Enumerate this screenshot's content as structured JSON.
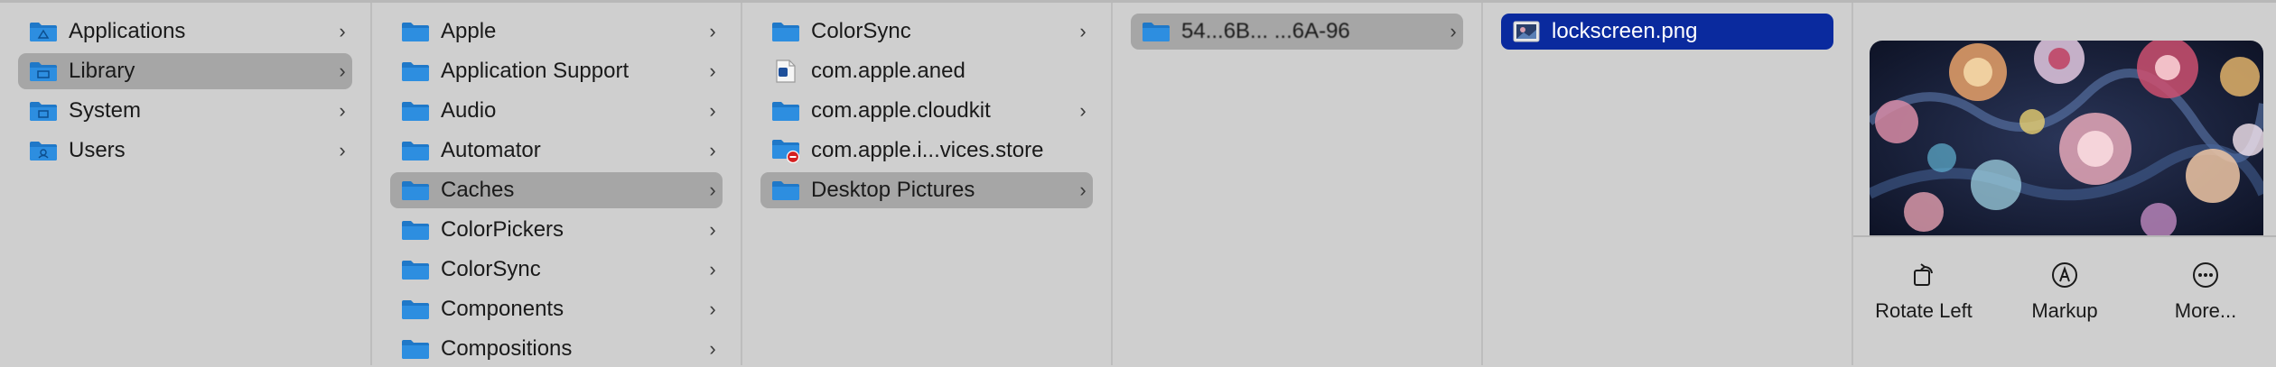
{
  "columns": {
    "col1": [
      {
        "label": "Applications",
        "icon": "applications-folder-icon",
        "chevron": true
      },
      {
        "label": "Library",
        "icon": "library-folder-icon",
        "chevron": true,
        "selected": true
      },
      {
        "label": "System",
        "icon": "system-folder-icon",
        "chevron": true
      },
      {
        "label": "Users",
        "icon": "users-folder-icon",
        "chevron": true
      }
    ],
    "col2": [
      {
        "label": "Apple",
        "chevron": true
      },
      {
        "label": "Application Support",
        "chevron": true
      },
      {
        "label": "Audio",
        "chevron": true
      },
      {
        "label": "Automator",
        "chevron": true
      },
      {
        "label": "Caches",
        "chevron": true,
        "selected": true
      },
      {
        "label": "ColorPickers",
        "chevron": true
      },
      {
        "label": "ColorSync",
        "chevron": true
      },
      {
        "label": "Components",
        "chevron": true
      },
      {
        "label": "Compositions",
        "chevron": true
      }
    ],
    "col3": [
      {
        "label": "ColorSync",
        "chevron": true
      },
      {
        "label": "com.apple.aned",
        "chevron": false
      },
      {
        "label": "com.apple.cloudkit",
        "chevron": true
      },
      {
        "label": "com.apple.i...vices.store",
        "chevron": false
      },
      {
        "label": "Desktop Pictures",
        "chevron": true,
        "selected": true
      }
    ],
    "col4": [
      {
        "label": "54...6B...  ...6A-96",
        "chevron": true,
        "selected": true
      }
    ],
    "col5": [
      {
        "label": "lockscreen.png",
        "active": true
      }
    ]
  },
  "preview": {
    "actions": [
      {
        "label": "Rotate Left",
        "icon": "rotate-left-icon"
      },
      {
        "label": "Markup",
        "icon": "markup-icon"
      },
      {
        "label": "More...",
        "icon": "more-icon"
      }
    ]
  },
  "colors": {
    "selection_gray": "#a6a6a6",
    "active_blue": "#0a2a9e",
    "folder_blue": "#1f78c8"
  }
}
